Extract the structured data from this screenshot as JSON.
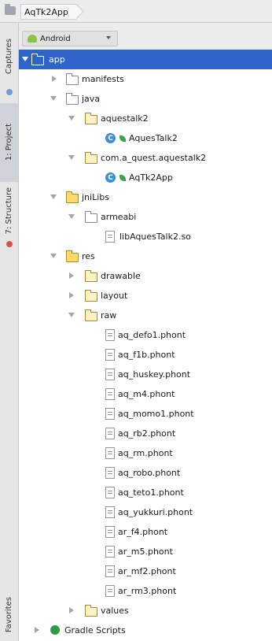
{
  "breadcrumb": {
    "project": "AqTk2App"
  },
  "side_tabs": {
    "captures": "Captures",
    "project": "1: Project",
    "structure": "7: Structure",
    "favorites": "Favorites"
  },
  "view_selector": {
    "value": "Android"
  },
  "tree": {
    "app": "app",
    "manifests": "manifests",
    "java": "java",
    "pkg1": "aquestalk2",
    "cls1": "AquesTalk2",
    "pkg2": "com.a_quest.aquestalk2",
    "cls2": "AqTk2App",
    "jnilibs": "jniLibs",
    "armeabi": "armeabi",
    "so": "libAquesTalk2.so",
    "res": "res",
    "drawable": "drawable",
    "layout": "layout",
    "raw": "raw",
    "raw_files": [
      "aq_defo1.phont",
      "aq_f1b.phont",
      "aq_huskey.phont",
      "aq_m4.phont",
      "aq_momo1.phont",
      "aq_rb2.phont",
      "aq_rm.phont",
      "aq_robo.phont",
      "aq_teto1.phont",
      "aq_yukkuri.phont",
      "ar_f4.phont",
      "ar_m5.phont",
      "ar_mf2.phont",
      "ar_rm3.phont"
    ],
    "values": "values",
    "gradle": "Gradle Scripts"
  },
  "colors": {
    "selection": "#2f65ca",
    "strip": "#e6e6e6"
  }
}
